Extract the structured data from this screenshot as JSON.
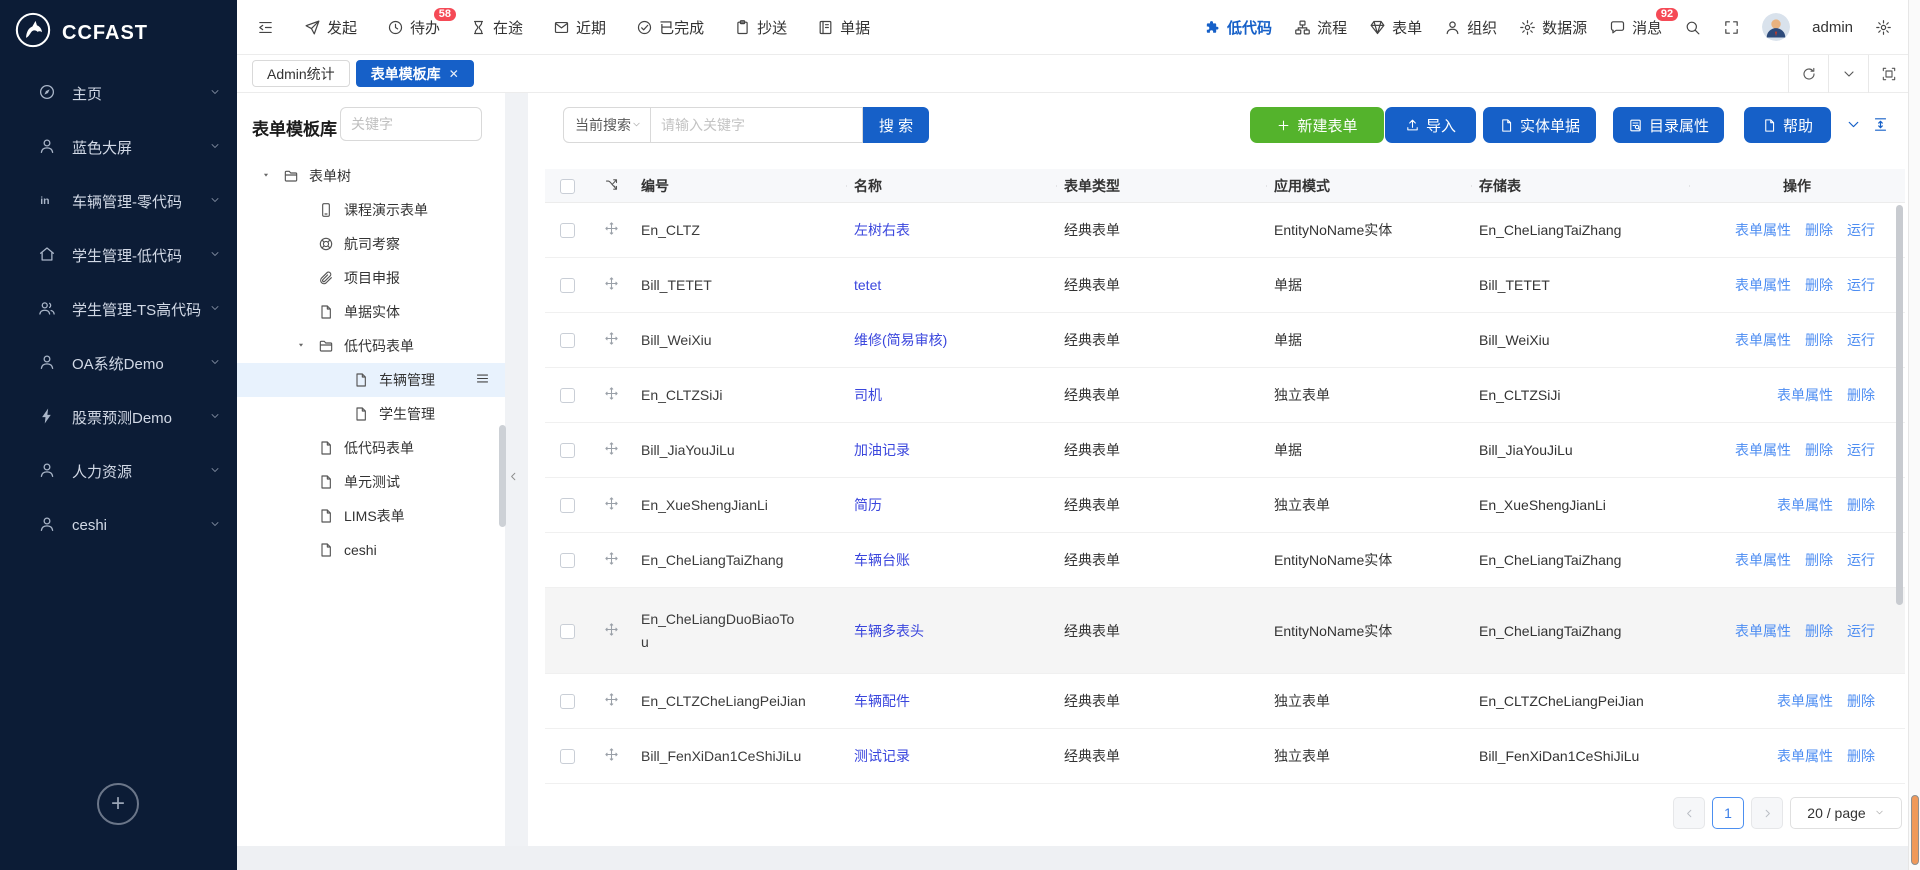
{
  "brand": {
    "name": "CCFAST"
  },
  "sidebar": {
    "items": [
      {
        "icon": "compass",
        "label": "主页"
      },
      {
        "icon": "user",
        "label": "蓝色大屏"
      },
      {
        "icon": "in-badge",
        "label": "车辆管理-零代码"
      },
      {
        "icon": "home",
        "label": "学生管理-低代码"
      },
      {
        "icon": "users",
        "label": "学生管理-TS高代码"
      },
      {
        "icon": "user",
        "label": "OA系统Demo"
      },
      {
        "icon": "bolt",
        "label": "股票预测Demo"
      },
      {
        "icon": "user",
        "label": "人力资源"
      },
      {
        "icon": "user",
        "label": "ceshi"
      }
    ]
  },
  "navbar": {
    "left": [
      {
        "name": "menu-fold",
        "icon": "menu-fold",
        "label": ""
      },
      {
        "name": "initiate",
        "icon": "send",
        "label": "发起"
      },
      {
        "name": "todo",
        "icon": "clock",
        "label": "待办",
        "badge": "58"
      },
      {
        "name": "in-transit",
        "icon": "hourglass",
        "label": "在途"
      },
      {
        "name": "recent",
        "icon": "mail",
        "label": "近期"
      },
      {
        "name": "completed",
        "icon": "check-circle",
        "label": "已完成"
      },
      {
        "name": "cc",
        "icon": "clipboard",
        "label": "抄送"
      },
      {
        "name": "documents",
        "icon": "ledger",
        "label": "单据"
      }
    ],
    "right": [
      {
        "name": "low-code",
        "icon": "puzzle",
        "label": "低代码",
        "active": true
      },
      {
        "name": "workflow",
        "icon": "sitemap",
        "label": "流程"
      },
      {
        "name": "forms",
        "icon": "gem",
        "label": "表单"
      },
      {
        "name": "organization",
        "icon": "user",
        "label": "组织"
      },
      {
        "name": "data-source",
        "icon": "gear",
        "label": "数据源"
      },
      {
        "name": "messages",
        "icon": "chat",
        "label": "消息",
        "badge": "92"
      },
      {
        "name": "search",
        "icon": "search",
        "label": ""
      },
      {
        "name": "fullscreen",
        "icon": "expand",
        "label": ""
      },
      {
        "name": "avatar",
        "icon": "avatar",
        "label": ""
      },
      {
        "name": "username",
        "icon": "",
        "label": "admin"
      },
      {
        "name": "settings",
        "icon": "gear",
        "label": ""
      }
    ]
  },
  "tabs": [
    {
      "label": "Admin统计",
      "active": false,
      "closable": false
    },
    {
      "label": "表单模板库",
      "active": true,
      "closable": true
    }
  ],
  "tree_panel": {
    "title": "表单模板库",
    "search_placeholder": "关键字",
    "nodes": [
      {
        "label": "表单树",
        "icon": "folder",
        "level": 0,
        "caret": true
      },
      {
        "label": "课程演示表单",
        "icon": "mobile",
        "level": 1
      },
      {
        "label": "航司考察",
        "icon": "lifebuoy",
        "level": 1
      },
      {
        "label": "项目申报",
        "icon": "paperclip",
        "level": 1
      },
      {
        "label": "单据实体",
        "icon": "file",
        "level": 1
      },
      {
        "label": "低代码表单",
        "icon": "folder",
        "level": 1,
        "caret": true
      },
      {
        "label": "车辆管理",
        "icon": "file",
        "level": 2,
        "selected": true
      },
      {
        "label": "学生管理",
        "icon": "file",
        "level": 2
      },
      {
        "label": "低代码表单",
        "icon": "file",
        "level": 1
      },
      {
        "label": "单元测试",
        "icon": "file",
        "level": 1
      },
      {
        "label": "LIMS表单",
        "icon": "file",
        "level": 1
      },
      {
        "label": "ceshi",
        "icon": "file",
        "level": 1
      }
    ]
  },
  "toolbar": {
    "search_scope": "当前搜索",
    "search_placeholder": "请输入关键字",
    "search_button": "搜 索",
    "buttons": [
      {
        "name": "new-form",
        "label": "新建表单",
        "icon": "plus",
        "color": "green"
      },
      {
        "name": "import",
        "label": "导入",
        "icon": "upload",
        "color": "blue"
      },
      {
        "name": "entity-bill",
        "label": "实体单据",
        "icon": "file",
        "color": "blue"
      },
      {
        "name": "directory-properties",
        "label": "目录属性",
        "icon": "file-search",
        "color": "blue"
      },
      {
        "name": "help",
        "label": "帮助",
        "icon": "file",
        "color": "blue"
      }
    ]
  },
  "table": {
    "columns": [
      "编号",
      "名称",
      "表单类型",
      "应用模式",
      "存储表",
      "操作"
    ],
    "rows": [
      {
        "id": "En_CLTZ",
        "name": "左树右表",
        "type": "经典表单",
        "mode": "EntityNoName实体",
        "storage": "En_CheLiangTaiZhang",
        "actions": [
          "表单属性",
          "删除",
          "运行"
        ]
      },
      {
        "id": "Bill_TETET",
        "name": "tetet",
        "type": "经典表单",
        "mode": "单据",
        "storage": "Bill_TETET",
        "actions": [
          "表单属性",
          "删除",
          "运行"
        ]
      },
      {
        "id": "Bill_WeiXiu",
        "name": "维修(简易审核)",
        "type": "经典表单",
        "mode": "单据",
        "storage": "Bill_WeiXiu",
        "actions": [
          "表单属性",
          "删除",
          "运行"
        ]
      },
      {
        "id": "En_CLTZSiJi",
        "name": "司机",
        "type": "经典表单",
        "mode": "独立表单",
        "storage": "En_CLTZSiJi",
        "actions": [
          "表单属性",
          "删除"
        ]
      },
      {
        "id": "Bill_JiaYouJiLu",
        "name": "加油记录",
        "type": "经典表单",
        "mode": "单据",
        "storage": "Bill_JiaYouJiLu",
        "actions": [
          "表单属性",
          "删除",
          "运行"
        ]
      },
      {
        "id": "En_XueShengJianLi",
        "name": "简历",
        "type": "经典表单",
        "mode": "独立表单",
        "storage": "En_XueShengJianLi",
        "actions": [
          "表单属性",
          "删除"
        ]
      },
      {
        "id": "En_CheLiangTaiZhang",
        "name": "车辆台账",
        "type": "经典表单",
        "mode": "EntityNoName实体",
        "storage": "En_CheLiangTaiZhang",
        "actions": [
          "表单属性",
          "删除",
          "运行"
        ]
      },
      {
        "id": "En_CheLiangDuoBiaoTou",
        "id_display": "En_CheLiangDuoBiaoTo\nu",
        "name": "车辆多表头",
        "type": "经典表单",
        "mode": "EntityNoName实体",
        "storage": "En_CheLiangTaiZhang",
        "actions": [
          "表单属性",
          "删除",
          "运行"
        ],
        "highlight": true
      },
      {
        "id": "En_CLTZCheLiangPeiJian",
        "name": "车辆配件",
        "type": "经典表单",
        "mode": "独立表单",
        "storage": "En_CLTZCheLiangPeiJian",
        "actions": [
          "表单属性",
          "删除"
        ]
      },
      {
        "id": "Bill_FenXiDan1CeShiJiLu",
        "name": "测试记录",
        "type": "经典表单",
        "mode": "独立表单",
        "storage": "Bill_FenXiDan1CeShiJiLu",
        "actions": [
          "表单属性",
          "删除"
        ]
      }
    ]
  },
  "pagination": {
    "page": "1",
    "page_size": "20 / page"
  },
  "colors": {
    "primary_blue": "#1660c8",
    "green": "#54b32c",
    "badge_red": "#f54a56",
    "name_link_blue": "#3a46dd",
    "action_link_blue": "#4d8df2",
    "sidebar_navy": "#0c1c36"
  }
}
